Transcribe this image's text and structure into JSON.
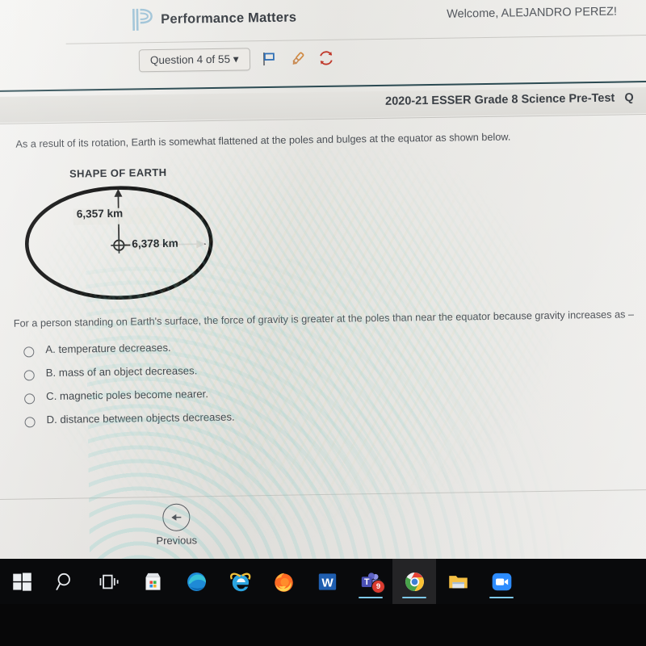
{
  "header": {
    "logo_icon": "performance-matters-p-logo",
    "brand": "Performance Matters",
    "welcome": "Welcome, ALEJANDRO PEREZ!",
    "question_selector": "Question 4 of 55 ",
    "question_selector_caret": "▾",
    "tools": [
      {
        "name": "flag-icon",
        "label": "Flag question"
      },
      {
        "name": "highlighter-icon",
        "label": "Highlighter"
      },
      {
        "name": "reset-icon",
        "label": "Reset"
      }
    ]
  },
  "test": {
    "title": "2020-21 ESSER Grade 8 Science Pre-Test",
    "title_overflow": "Q"
  },
  "question": {
    "intro": "As a result of its rotation, Earth is somewhat flattened at the poles and bulges at the equator as shown below.",
    "stem": "For a person standing on Earth's surface, the force of gravity is greater at the poles than near the equator because gravity increases as –",
    "choices": [
      {
        "letter": "A.",
        "text": "temperature decreases.",
        "selected": false
      },
      {
        "letter": "B.",
        "text": "mass of an object decreases.",
        "selected": false
      },
      {
        "letter": "C.",
        "text": "magnetic poles become nearer.",
        "selected": false
      },
      {
        "letter": "D.",
        "text": "distance between objects decreases.",
        "selected": false
      }
    ]
  },
  "figure": {
    "title": "SHAPE OF EARTH",
    "polar_label": "6,357 km",
    "equatorial_label": "6,378 km",
    "center_marker": "earth-center-icon",
    "shape": "oblate-ellipse"
  },
  "footer": {
    "previous_label": "Previous",
    "previous_icon": "arrow-left-circle-icon"
  },
  "taskbar": {
    "items": [
      {
        "name": "start-button",
        "icon": "windows-logo-icon",
        "running": false,
        "badge": ""
      },
      {
        "name": "search-button",
        "icon": "search-icon",
        "running": false,
        "badge": ""
      },
      {
        "name": "task-view-button",
        "icon": "task-view-icon",
        "running": false,
        "badge": ""
      },
      {
        "name": "microsoft-store-button",
        "icon": "store-icon",
        "running": false,
        "badge": ""
      },
      {
        "name": "edge-button",
        "icon": "edge-icon",
        "running": false,
        "badge": ""
      },
      {
        "name": "internet-explorer-button",
        "icon": "internet-explorer-icon",
        "running": false,
        "badge": ""
      },
      {
        "name": "firefox-button",
        "icon": "firefox-icon",
        "running": false,
        "badge": ""
      },
      {
        "name": "word-button",
        "icon": "word-icon",
        "running": false,
        "badge": ""
      },
      {
        "name": "teams-button",
        "icon": "teams-icon",
        "running": true,
        "badge": "9"
      },
      {
        "name": "chrome-button",
        "icon": "chrome-icon",
        "running": true,
        "badge": ""
      },
      {
        "name": "file-explorer-button",
        "icon": "folder-icon",
        "running": false,
        "badge": ""
      },
      {
        "name": "zoom-button",
        "icon": "video-camera-icon",
        "running": true,
        "badge": ""
      }
    ]
  },
  "colors": {
    "brand_blue": "#8fb9cf",
    "rule_navy": "#2b4a52",
    "flag_blue": "#2f6fb5",
    "highlighter_orange": "#d08a43",
    "reset_red": "#c0392b",
    "badge_red": "#d93b30",
    "taskbar": "#090a0c"
  }
}
